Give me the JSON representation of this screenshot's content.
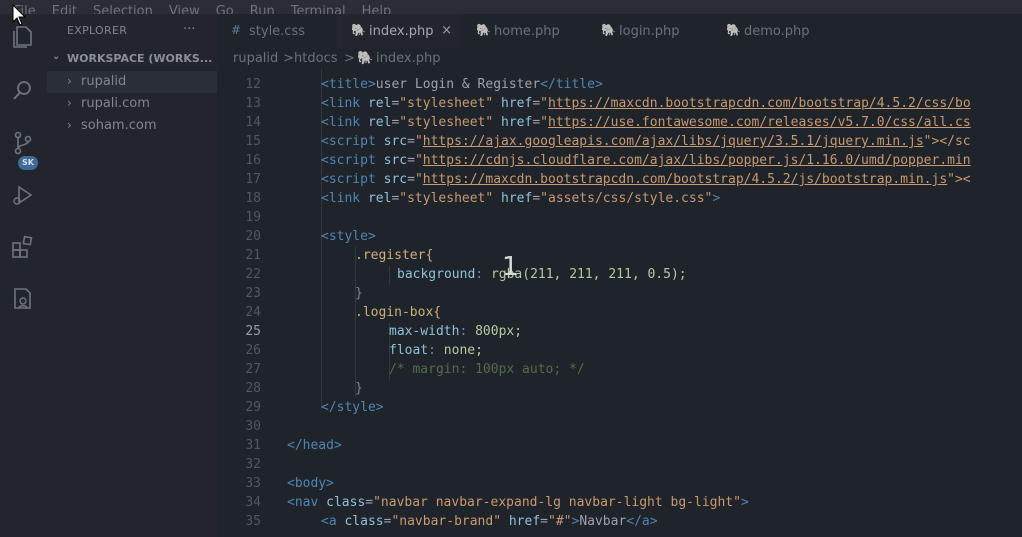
{
  "menu": [
    "File",
    "Edit",
    "Selection",
    "View",
    "Go",
    "Run",
    "Terminal",
    "Help"
  ],
  "sidebar": {
    "title": "EXPLORER",
    "more": "···",
    "workspace": "WORKSPACE (WORKS...",
    "items": [
      {
        "label": "rupalid"
      },
      {
        "label": "rupali.com"
      },
      {
        "label": "soham.com"
      }
    ]
  },
  "activity": {
    "badge": "SK"
  },
  "tabs": [
    {
      "label": "style.css",
      "icon": "#"
    },
    {
      "label": "index.php",
      "icon": "🐘",
      "close": "×"
    },
    {
      "label": "home.php",
      "icon": "🐘"
    },
    {
      "label": "login.php",
      "icon": "🐘"
    },
    {
      "label": "demo.php",
      "icon": "🐘"
    }
  ],
  "breadcrumb": {
    "parts": [
      "rupalid",
      ">",
      "htdocs",
      ">",
      "index.php"
    ]
  },
  "editor": {
    "lines": [
      {
        "n": "12"
      },
      {
        "n": "13"
      },
      {
        "n": "14"
      },
      {
        "n": "15"
      },
      {
        "n": "16"
      },
      {
        "n": "17"
      },
      {
        "n": "18"
      },
      {
        "n": "19"
      },
      {
        "n": "20"
      },
      {
        "n": "21"
      },
      {
        "n": "22"
      },
      {
        "n": "23"
      },
      {
        "n": "24"
      },
      {
        "n": "25"
      },
      {
        "n": "26"
      },
      {
        "n": "27"
      },
      {
        "n": "28"
      },
      {
        "n": "29"
      },
      {
        "n": "30"
      },
      {
        "n": "31"
      },
      {
        "n": "32"
      },
      {
        "n": "33"
      },
      {
        "n": "34"
      },
      {
        "n": "35"
      }
    ],
    "text": {
      "l12_title": "user Login & Register",
      "l13_href": "https://maxcdn.bootstrapcdn.com/bootstrap/4.5.2/css/bo",
      "l14_href": "https://use.fontawesome.com/releases/v5.7.0/css/all.cs",
      "l15_src": "https://ajax.googleapis.com/ajax/libs/jquery/3.5.1/jquery.min.js",
      "l15_tail": "\"></sc",
      "l16_src": "https://cdnjs.cloudflare.com/ajax/libs/popper.js/1.16.0/umd/popper.min",
      "l17_src": "https://maxcdn.bootstrapcdn.com/bootstrap/4.5.2/js/bootstrap.min.js",
      "l17_tail": "\"><",
      "l18_href": "\"assets/css/style.css\"",
      "l21_sel": ".register{",
      "l22_prop": "background",
      "l22_val": "rgba(211, 211, 211, 0.5);",
      "l23": "}",
      "l24_sel": ".login-box{",
      "l25_prop": "max-width",
      "l25_val": "800px;",
      "l26_prop": "float",
      "l26_val": "none;",
      "l27_cmt": "/* margin: 100px auto; */",
      "l28": "}",
      "l34_class": "\"navbar navbar-expand-lg navbar-light bg-light\"",
      "l35_class": "\"navbar-brand\"",
      "l35_href": "\"#\"",
      "l35_text": "Navbar"
    }
  },
  "overlay": "1"
}
